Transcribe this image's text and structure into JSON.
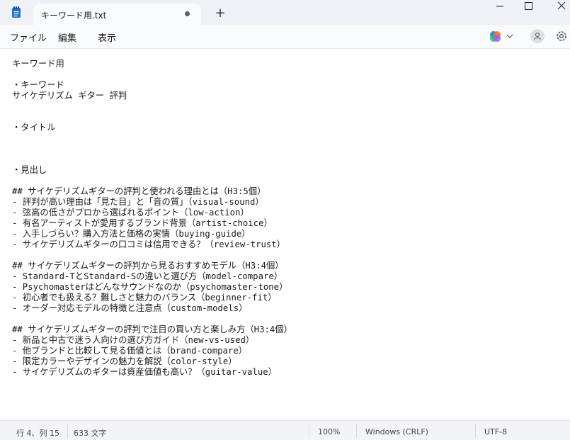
{
  "window": {
    "tab_title": "キーワード用.txt",
    "new_tab": "+",
    "app_icon": "notepad-icon",
    "controls": [
      "minimize-icon",
      "maximize-icon",
      "close-icon"
    ]
  },
  "menu": {
    "file": "ファイル",
    "edit": "編集",
    "view": "表示"
  },
  "toolbar_icons": [
    "copilot-icon",
    "chevron-down-icon",
    "account-icon",
    "gear-icon"
  ],
  "document": {
    "lines": [
      "キーワード用",
      "",
      "・キーワード",
      "サイケデリズム ギター 評判",
      "",
      "",
      "・タイトル",
      "",
      "",
      "",
      "・見出し",
      "",
      "## サイケデリズムギターの評判と使われる理由とは（H3:5個）",
      "- 評判が高い理由は「見た目」と「音の質」（visual-sound）",
      "- 弦高の低さがプロから選ばれるポイント（low-action）",
      "- 有名アーティストが愛用するブランド背景（artist-choice）",
      "- 入手しづらい？購入方法と価格の実情（buying-guide）",
      "- サイケデリズムギターの口コミは信用できる？（review-trust）",
      "",
      "## サイケデリズムギターの評判から見るおすすめモデル（H3:4個）",
      "- Standard-TとStandard-Sの違いと選び方（model-compare）",
      "- Psychomasterはどんなサウンドなのか（psychomaster-tone）",
      "- 初心者でも扱える？難しさと魅力のバランス（beginner-fit）",
      "- オーダー対応モデルの特徴と注意点（custom-models）",
      "",
      "## サイケデリズムギターの評判で注目の買い方と楽しみ方（H3:4個）",
      "- 新品と中古で迷う人向けの選び方ガイド（new-vs-used）",
      "- 他ブランドと比較して見る価値とは（brand-compare）",
      "- 限定カラーやデザインの魅力を解説（color-style）",
      "- サイケデリズムのギターは資産価値も高い？（guitar-value）"
    ]
  },
  "status": {
    "position": "行 4、列 15",
    "char_count": "633 文字",
    "zoom": "100%",
    "line_ending": "Windows (CRLF)",
    "encoding": "UTF-8"
  },
  "colors": {
    "titlebar_bg": "#eef1f6",
    "editor_bg": "#ffffff",
    "statusbar_bg": "#f3f4f7",
    "notepad_blue": "#1f6fd1"
  }
}
